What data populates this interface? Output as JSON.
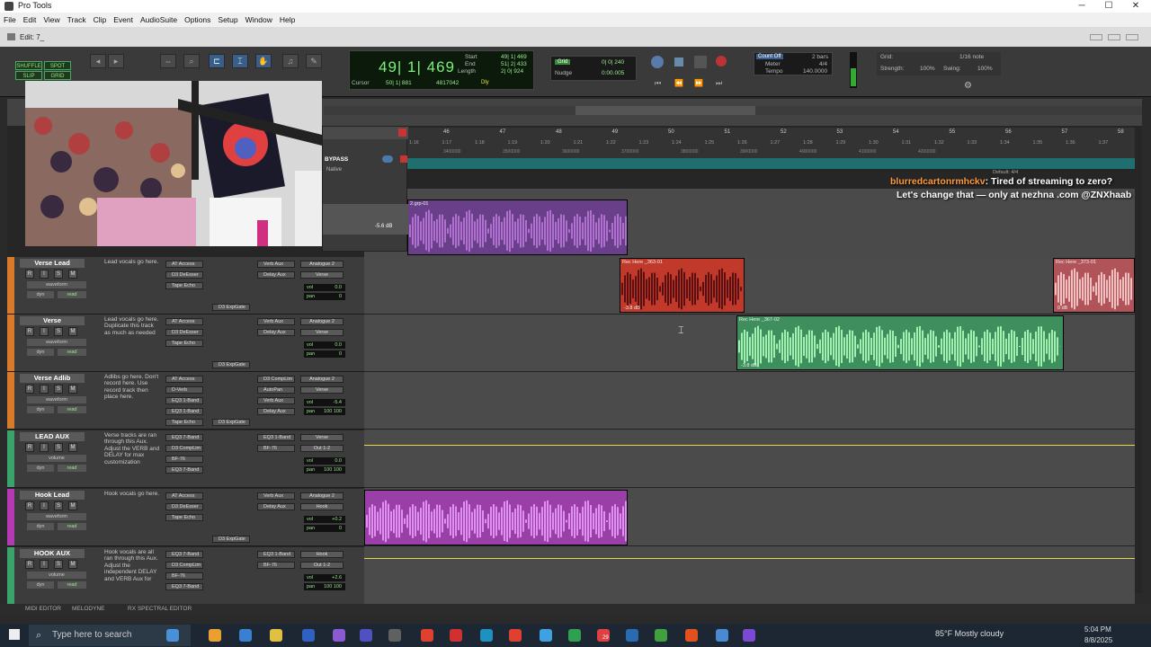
{
  "window": {
    "title": "Pro Tools",
    "edit_title": "Edit: 7_"
  },
  "menu": [
    "File",
    "Edit",
    "View",
    "Track",
    "Clip",
    "Event",
    "AudioSuite",
    "Options",
    "Setup",
    "Window",
    "Help"
  ],
  "modes": {
    "shuffle": "SHUFFLE",
    "spot": "SPOT",
    "slip": "SLIP",
    "grid": "GRID"
  },
  "counter": {
    "main": "49| 1| 469",
    "start_label": "Start",
    "end_label": "End",
    "length_label": "Length",
    "start": "49| 1| 469",
    "end": "51| 2| 433",
    "length": "2| 0| 924",
    "cursor_label": "Cursor",
    "cursor": "50| 1| 881",
    "cursor_val": "4817042",
    "dly": "Dly"
  },
  "grid_nudge": {
    "grid_label": "Grid",
    "grid_val": "0| 0| 240",
    "nudge_label": "Nudge",
    "nudge_val": "0:00.005"
  },
  "counters2": {
    "count_off": "Count Off",
    "meter": "Meter",
    "tempo": "Tempo",
    "bars": "2 bars",
    "sig": "4/4",
    "bpm": "140.0000"
  },
  "grid_panel": {
    "grid_label": "Grid:",
    "grid_val": "1/16 note",
    "strength_label": "Strength:",
    "strength": "100%",
    "swing_label": "Swing:",
    "swing": "100%"
  },
  "ruler": {
    "bars": [
      "46",
      "47",
      "48",
      "49",
      "50",
      "51",
      "52",
      "53",
      "54",
      "55",
      "56",
      "57",
      "58"
    ],
    "ticks": [
      "1:16",
      "1:17",
      "1:18",
      "1:19",
      "1:20",
      "1:21",
      "1:22",
      "1:23",
      "1:24",
      "1:25",
      "1:26",
      "1:27",
      "1:28",
      "1:29",
      "1:30",
      "1:31",
      "1:32",
      "1:33",
      "1:34",
      "1:35",
      "1:36",
      "1:37"
    ],
    "samples": [
      "3400000",
      "3500000",
      "3600000",
      "3700000",
      "3800000",
      "3900000",
      "4000000",
      "4100000",
      "4200000"
    ],
    "default": "Default: 4/4"
  },
  "plugin": {
    "bypass": "BYPASS",
    "native": "Native",
    "val": "-5.6 dB"
  },
  "tracks": [
    {
      "name": "Verse Lead",
      "view": "waveform",
      "auto": "dyn",
      "mode": "read",
      "comment": "Lead vocals go here.",
      "inserts": [
        "AT Access",
        "D3 DeEsser",
        "Tape Echo"
      ],
      "sends": [
        "Verb Aux",
        "Delay Aux"
      ],
      "io": [
        "Analogue 2",
        "Verse"
      ],
      "vol": "0.0",
      "pan": "0",
      "ins_extra": "D3 ExpGate",
      "color": "#d97a2b"
    },
    {
      "name": "Verse",
      "view": "waveform",
      "auto": "dyn",
      "mode": "read",
      "comment": "Lead vocals go here. Duplicate this track as much as needed",
      "inserts": [
        "AT Access",
        "D3 DeEsser",
        "Tape Echo"
      ],
      "sends": [
        "Verb Aux",
        "Delay Aux"
      ],
      "io": [
        "Analogue 2",
        "Verse"
      ],
      "vol": "0.0",
      "pan": "0",
      "ins_extra": "D3 ExpGate",
      "color": "#d97a2b"
    },
    {
      "name": "Verse Adlib",
      "view": "waveform",
      "auto": "dyn",
      "mode": "read",
      "comment": "Adlibs go here. Don't record here. Use record track then place here.",
      "inserts": [
        "AT Access",
        "D-Verb",
        "EQ3 1-Band",
        "EQ3 1-Band",
        "Tape Echo"
      ],
      "sends": [
        "D3 CompLim",
        "AutoPan",
        "Verb Aux",
        "Delay Aux"
      ],
      "io": [
        "Analogue 2",
        "Verse"
      ],
      "vol": "-5.4",
      "pan": "100 100",
      "ins_extra": "D3 ExpGate",
      "color": "#d97a2b"
    },
    {
      "name": "LEAD AUX",
      "view": "volume",
      "auto": "dyn",
      "mode": "read",
      "comment": "Verse tracks are ran through this Aux. Adjust the VERB and DELAY for max customization",
      "inserts": [
        "EQ3 7-Band",
        "D3 CompLim",
        "BF-76",
        "EQ3 7-Band"
      ],
      "sends": [
        "EQ3 1-Band",
        "BF-76"
      ],
      "io": [
        "Verse",
        "Out 1-2"
      ],
      "vol": "0.0",
      "pan": "100 100",
      "ins_extra": "",
      "color": "#3aa36b"
    },
    {
      "name": "Hook Lead",
      "view": "waveform",
      "auto": "dyn",
      "mode": "read",
      "comment": "Hook vocals go here.",
      "inserts": [
        "AT Access",
        "D3 DeEsser",
        "Tape Echo"
      ],
      "sends": [
        "Verb Aux",
        "Delay Aux"
      ],
      "io": [
        "Analogue 2",
        "Hook"
      ],
      "vol": "+0.2",
      "pan": "0",
      "ins_extra": "D3 ExpGate",
      "color": "#b43ab4"
    },
    {
      "name": "HOOK AUX",
      "view": "volume",
      "auto": "dyn",
      "mode": "read",
      "comment": "Hook vocals are all ran through this Aux. Adjust the independent DELAY and VERB Aux for",
      "inserts": [
        "EQ3 7-Band",
        "D3 CompLim",
        "BF-76",
        "EQ3 7-Band"
      ],
      "sends": [
        "EQ3 1-Band",
        "BF-76"
      ],
      "io": [
        "Hook",
        "Out 1-2"
      ],
      "vol": "+2.6",
      "pan": "100 100",
      "ins_extra": "",
      "color": "#3aa36b"
    }
  ],
  "clips": [
    {
      "name": "2.grp-01",
      "db": "",
      "color": "#6a3f8a"
    },
    {
      "name": "Rec Here _363-01",
      "db": "-3.8 dB",
      "color": "#c0392b"
    },
    {
      "name": "Rec Here _373-01",
      "db": "0 dB",
      "color": "#b0545a"
    },
    {
      "name": "Rec Here _367-02",
      "db": "-3.8 dB",
      "color": "#3f8f5e"
    },
    {
      "name": "",
      "db": "",
      "color": "#9a3fa8"
    }
  ],
  "chat": {
    "user": "blurredcartonrmhckv",
    "message": ": Tired of streaming to zero?",
    "line2": "Let's change that — only at nezhna .com @ZNXhaab"
  },
  "bottom": {
    "midi": "MIDI EDITOR",
    "melodyne": "MELODYNE",
    "rx": "RX SPECTRAL EDITOR"
  },
  "taskbar": {
    "search": "Type here to search",
    "weather": "85°F  Mostly cloudy",
    "time": "5:04 PM",
    "date": "8/8/2025",
    "badge": "29"
  },
  "colors": {
    "accent": "#7df07a",
    "verse": "#d97a2b",
    "hook": "#b43ab4",
    "aux": "#3aa36b"
  }
}
